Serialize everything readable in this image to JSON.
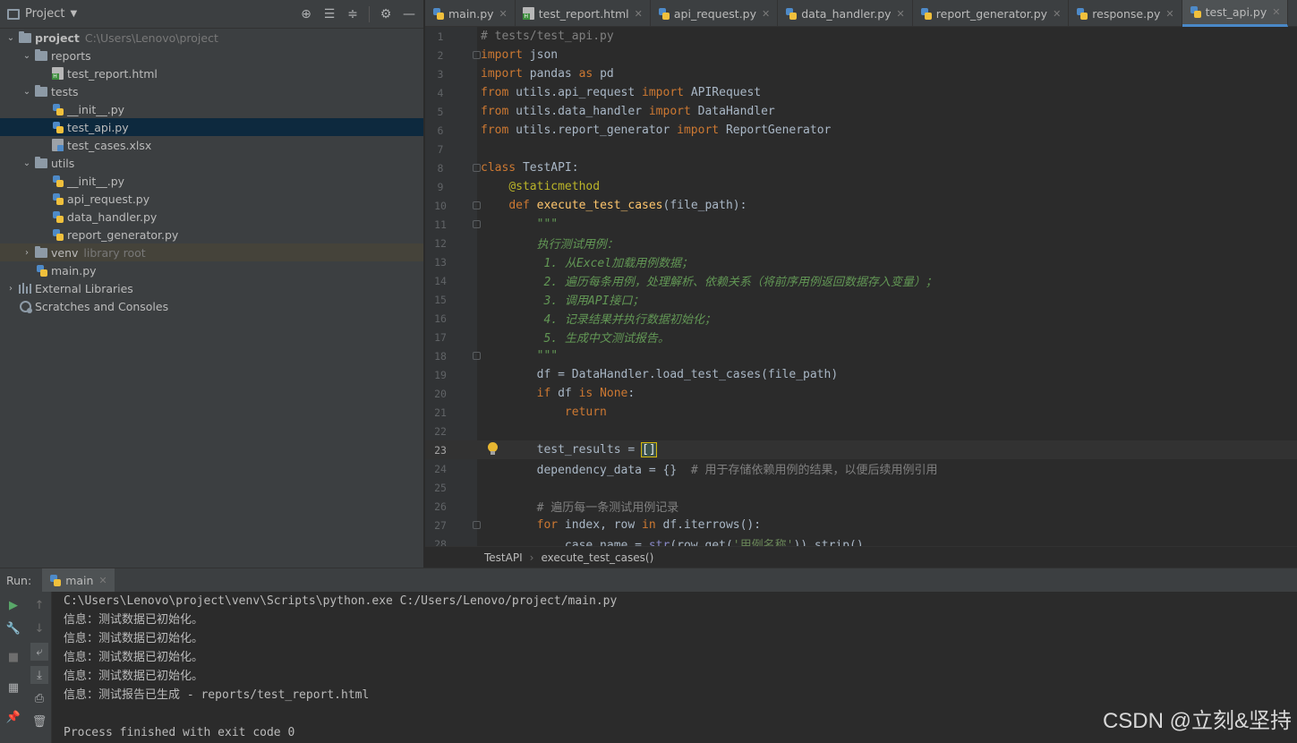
{
  "project_panel": {
    "title": "Project",
    "tree": [
      {
        "label": "project",
        "hint": "C:\\Users\\Lenovo\\project",
        "depth": 0,
        "type": "folder",
        "expanded": true
      },
      {
        "label": "reports",
        "depth": 1,
        "type": "folder",
        "expanded": true
      },
      {
        "label": "test_report.html",
        "depth": 2,
        "type": "html"
      },
      {
        "label": "tests",
        "depth": 1,
        "type": "folder",
        "expanded": true
      },
      {
        "label": "__init__.py",
        "depth": 2,
        "type": "py"
      },
      {
        "label": "test_api.py",
        "depth": 2,
        "type": "py",
        "selected": true
      },
      {
        "label": "test_cases.xlsx",
        "depth": 2,
        "type": "xlsx"
      },
      {
        "label": "utils",
        "depth": 1,
        "type": "folder",
        "expanded": true
      },
      {
        "label": "__init__.py",
        "depth": 2,
        "type": "py"
      },
      {
        "label": "api_request.py",
        "depth": 2,
        "type": "py"
      },
      {
        "label": "data_handler.py",
        "depth": 2,
        "type": "py"
      },
      {
        "label": "report_generator.py",
        "depth": 2,
        "type": "py"
      },
      {
        "label": "venv",
        "hint": "library root",
        "depth": 1,
        "type": "folder",
        "expanded": false,
        "dim": true
      },
      {
        "label": "main.py",
        "depth": 1,
        "type": "py"
      },
      {
        "label": "External Libraries",
        "depth": 0,
        "type": "libs",
        "expanded": false
      },
      {
        "label": "Scratches and Consoles",
        "depth": 0,
        "type": "scratch"
      }
    ]
  },
  "tabs": [
    {
      "label": "main.py",
      "type": "py"
    },
    {
      "label": "test_report.html",
      "type": "html"
    },
    {
      "label": "api_request.py",
      "type": "py"
    },
    {
      "label": "data_handler.py",
      "type": "py"
    },
    {
      "label": "report_generator.py",
      "type": "py"
    },
    {
      "label": "response.py",
      "type": "py"
    },
    {
      "label": "test_api.py",
      "type": "py",
      "active": true
    }
  ],
  "editor": {
    "current_line": 23,
    "lines": [
      [
        [
          "cm",
          "# tests/test_api.py"
        ]
      ],
      [
        [
          "kw",
          "import"
        ],
        [
          "",
          " json"
        ]
      ],
      [
        [
          "kw",
          "import"
        ],
        [
          "",
          " pandas "
        ],
        [
          "kw",
          "as"
        ],
        [
          "",
          " pd"
        ]
      ],
      [
        [
          "kw",
          "from"
        ],
        [
          "",
          " utils.api_request "
        ],
        [
          "kw",
          "import"
        ],
        [
          "",
          " APIRequest"
        ]
      ],
      [
        [
          "kw",
          "from"
        ],
        [
          "",
          " utils.data_handler "
        ],
        [
          "kw",
          "import"
        ],
        [
          "",
          " DataHandler"
        ]
      ],
      [
        [
          "kw",
          "from"
        ],
        [
          "",
          " utils.report_generator "
        ],
        [
          "kw",
          "import"
        ],
        [
          "",
          " ReportGenerator"
        ]
      ],
      [],
      [
        [
          "kw",
          "class"
        ],
        [
          "",
          " TestAPI:"
        ]
      ],
      [
        [
          "",
          "    "
        ],
        [
          "dec",
          "@staticmethod"
        ]
      ],
      [
        [
          "",
          "    "
        ],
        [
          "kw",
          "def"
        ],
        [
          "",
          " "
        ],
        [
          "fn",
          "execute_test_cases"
        ],
        [
          "",
          "(file_path):"
        ]
      ],
      [
        [
          "",
          "        "
        ],
        [
          "doc",
          "\"\"\""
        ]
      ],
      [
        [
          "",
          "        "
        ],
        [
          "doc",
          "执行测试用例："
        ]
      ],
      [
        [
          "",
          "         "
        ],
        [
          "doc",
          "1. 从Excel加载用例数据；"
        ]
      ],
      [
        [
          "",
          "         "
        ],
        [
          "doc",
          "2. 遍历每条用例，处理解析、依赖关系（将前序用例返回数据存入变量）；"
        ]
      ],
      [
        [
          "",
          "         "
        ],
        [
          "doc",
          "3. 调用API接口；"
        ]
      ],
      [
        [
          "",
          "         "
        ],
        [
          "doc",
          "4. 记录结果并执行数据初始化；"
        ]
      ],
      [
        [
          "",
          "         "
        ],
        [
          "doc",
          "5. 生成中文测试报告。"
        ]
      ],
      [
        [
          "",
          "        "
        ],
        [
          "doc",
          "\"\"\""
        ]
      ],
      [
        [
          "",
          "        df = DataHandler.load_test_cases(file_path)"
        ]
      ],
      [
        [
          "",
          "        "
        ],
        [
          "kw",
          "if"
        ],
        [
          "",
          " df "
        ],
        [
          "kw",
          "is"
        ],
        [
          "",
          " "
        ],
        [
          "kw",
          "None"
        ],
        [
          "",
          ":"
        ]
      ],
      [
        [
          "",
          "            "
        ],
        [
          "kw",
          "return"
        ]
      ],
      [],
      [
        [
          "",
          "        test_results = "
        ],
        [
          "brk",
          "[]"
        ]
      ],
      [
        [
          "",
          "        dependency_data = {}  "
        ],
        [
          "cm",
          "# 用于存储依赖用例的结果，以便后续用例引用"
        ]
      ],
      [],
      [
        [
          "",
          "        "
        ],
        [
          "cm",
          "# 遍历每一条测试用例记录"
        ]
      ],
      [
        [
          "",
          "        "
        ],
        [
          "kw",
          "for"
        ],
        [
          "",
          " index, row "
        ],
        [
          "kw",
          "in"
        ],
        [
          "",
          " df.iterrows():"
        ]
      ],
      [
        [
          "",
          "            case_name = "
        ],
        [
          "bi",
          "str"
        ],
        [
          "",
          "(row.get("
        ],
        [
          "str",
          "'用例名称'"
        ],
        [
          "",
          ")).strip()"
        ]
      ]
    ]
  },
  "breadcrumb": [
    "TestAPI",
    "execute_test_cases()"
  ],
  "run_panel": {
    "title": "Run:",
    "tab_label": "main",
    "console": [
      "C:\\Users\\Lenovo\\project\\venv\\Scripts\\python.exe C:/Users/Lenovo/project/main.py",
      "信息：测试数据已初始化。",
      "信息：测试数据已初始化。",
      "信息：测试数据已初始化。",
      "信息：测试数据已初始化。",
      "信息：测试报告已生成 - reports/test_report.html",
      "",
      "Process finished with exit code 0"
    ]
  },
  "watermark": "CSDN @立刻&坚持"
}
